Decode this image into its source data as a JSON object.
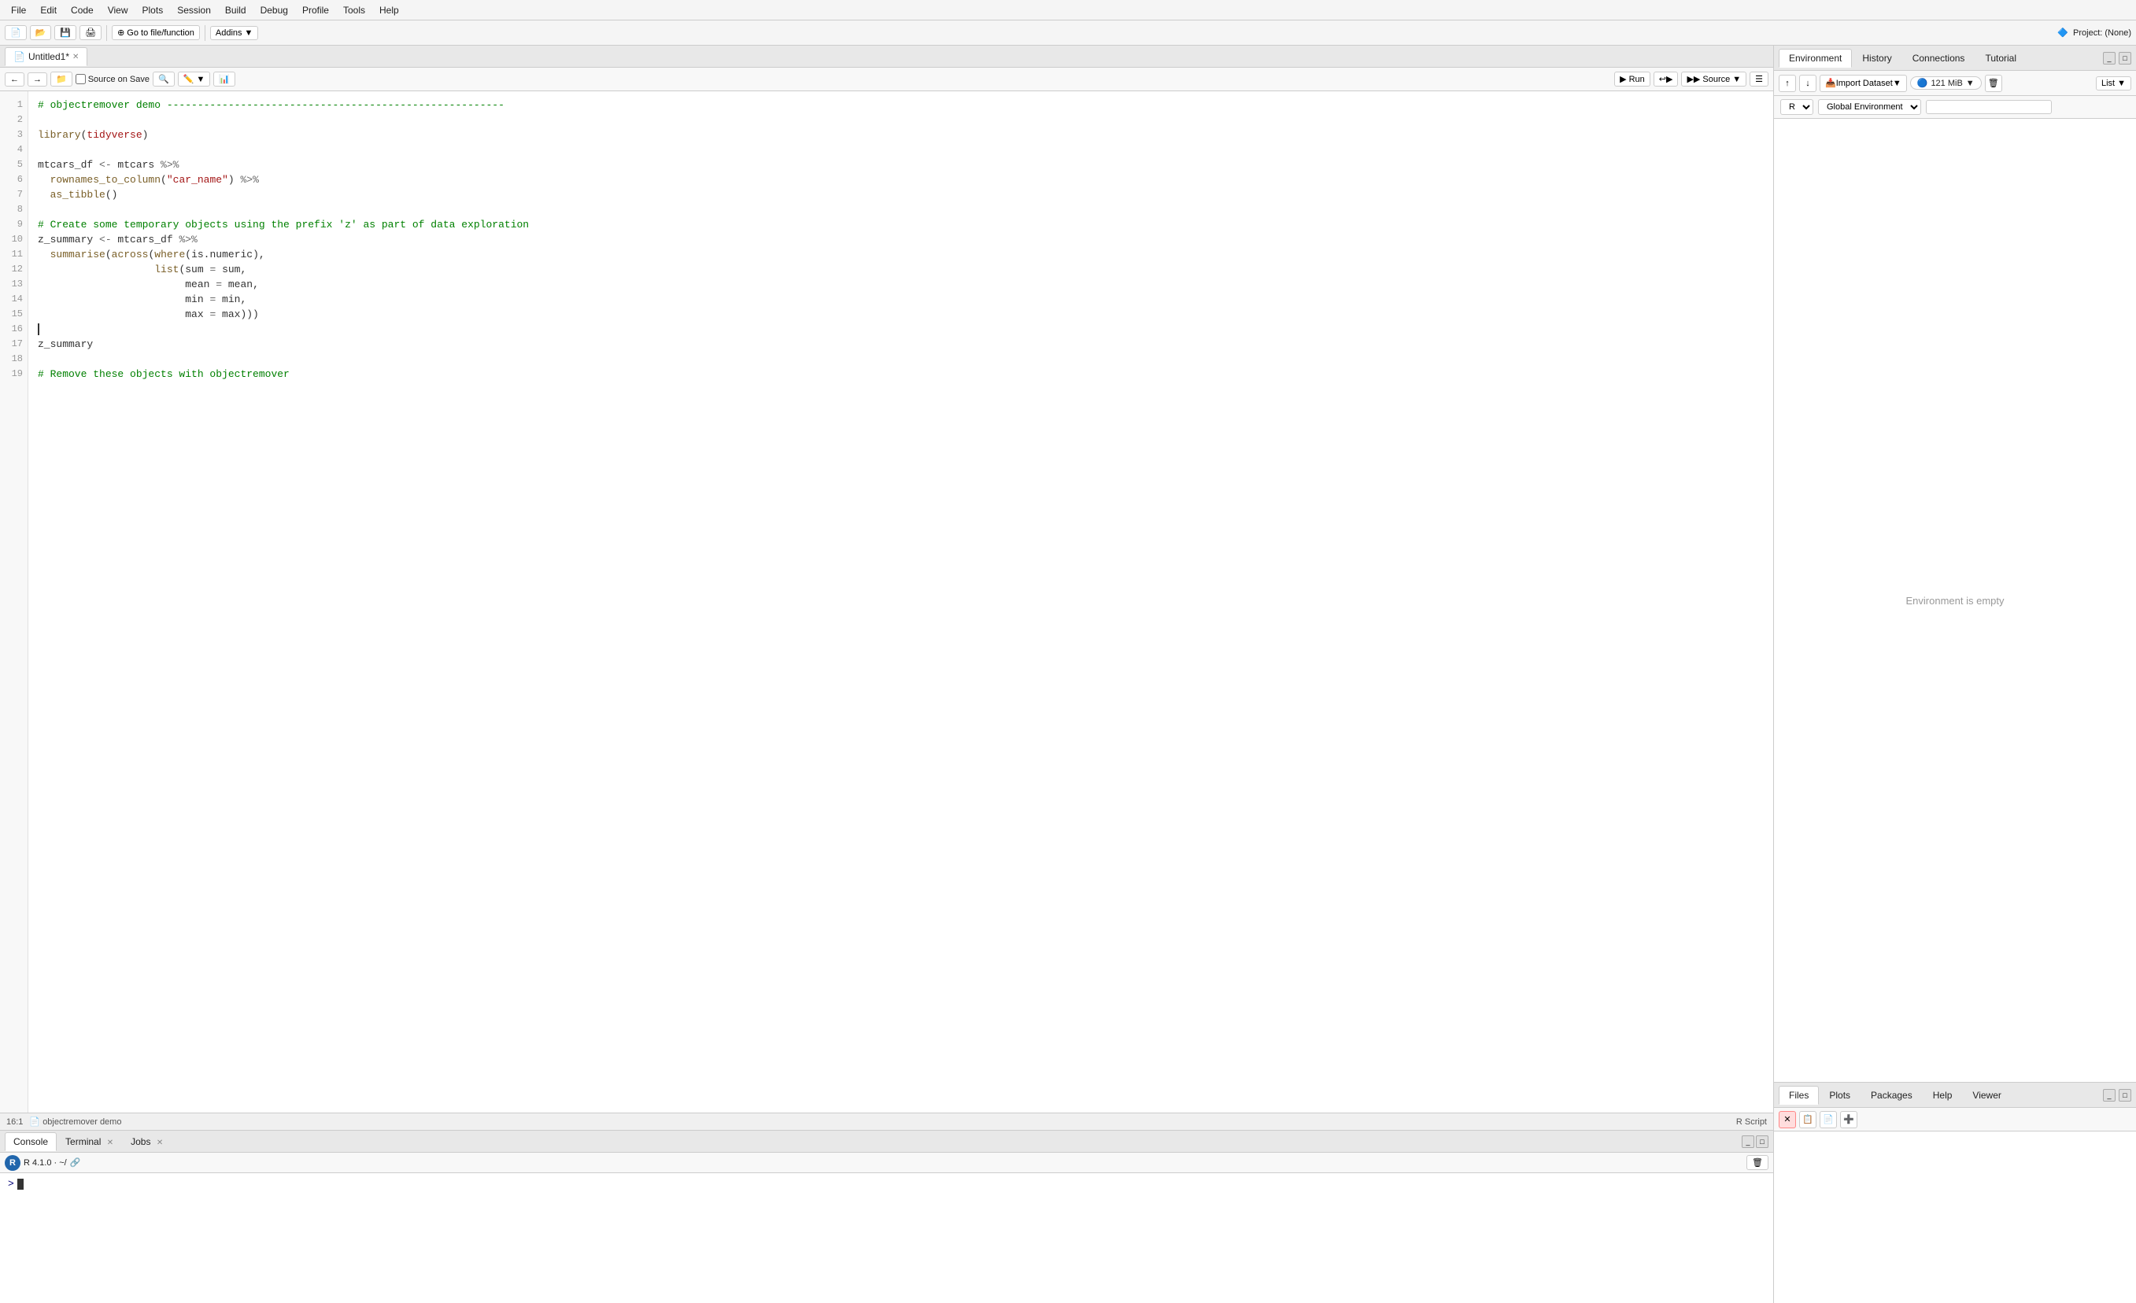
{
  "menubar": {
    "items": [
      "File",
      "Edit",
      "Code",
      "View",
      "Plots",
      "Session",
      "Build",
      "Debug",
      "Profile",
      "Tools",
      "Help"
    ]
  },
  "toolbar": {
    "goto_placeholder": "Go to file/function",
    "addins_label": "Addins",
    "project_label": "Project: (None)"
  },
  "editor": {
    "tab_title": "Untitled1*",
    "source_on_save": "Source on Save",
    "run_label": "Run",
    "source_label": "Source",
    "status_position": "16:1",
    "script_type": "R Script",
    "file_label": "objectremover demo",
    "lines": [
      {
        "num": 1,
        "text": "# objectremover demo -------------------------------------------------------",
        "type": "comment"
      },
      {
        "num": 2,
        "text": "",
        "type": "normal"
      },
      {
        "num": 3,
        "text": "library(tidyverse)",
        "type": "code"
      },
      {
        "num": 4,
        "text": "",
        "type": "normal"
      },
      {
        "num": 5,
        "text": "mtcars_df <- mtcars %>%",
        "type": "code"
      },
      {
        "num": 6,
        "text": "  rownames_to_column(\"car_name\") %>%",
        "type": "code"
      },
      {
        "num": 7,
        "text": "  as_tibble()",
        "type": "code"
      },
      {
        "num": 8,
        "text": "",
        "type": "normal"
      },
      {
        "num": 9,
        "text": "# Create some temporary objects using the prefix 'z' as part of data exploration",
        "type": "comment"
      },
      {
        "num": 10,
        "text": "z_summary <- mtcars_df %>%",
        "type": "code"
      },
      {
        "num": 11,
        "text": "  summarise(across(where(is.numeric),",
        "type": "code"
      },
      {
        "num": 12,
        "text": "                   list(sum = sum,",
        "type": "code"
      },
      {
        "num": 13,
        "text": "                        mean = mean,",
        "type": "code"
      },
      {
        "num": 14,
        "text": "                        min = min,",
        "type": "code"
      },
      {
        "num": 15,
        "text": "                        max = max)))",
        "type": "code"
      },
      {
        "num": 16,
        "text": "",
        "type": "cursor"
      },
      {
        "num": 17,
        "text": "z_summary",
        "type": "code"
      },
      {
        "num": 18,
        "text": "",
        "type": "normal"
      },
      {
        "num": 19,
        "text": "# Remove these objects with objectremover",
        "type": "comment"
      }
    ]
  },
  "console": {
    "tabs": [
      "Console",
      "Terminal",
      "Jobs"
    ],
    "active_tab": "Console",
    "r_version": "R 4.1.0 · ~/",
    "prompt": ">"
  },
  "right_panel": {
    "top_tabs": [
      "Environment",
      "History",
      "Connections",
      "Tutorial"
    ],
    "active_top_tab": "Environment",
    "import_dataset_label": "Import Dataset",
    "memory_label": "121 MiB",
    "list_label": "List",
    "global_env_label": "Global Environment",
    "empty_message": "Environment is empty",
    "search_placeholder": "",
    "bottom_tabs": [
      "Files",
      "Plots",
      "Packages",
      "Help",
      "Viewer"
    ],
    "active_bottom_tab": "Files"
  }
}
